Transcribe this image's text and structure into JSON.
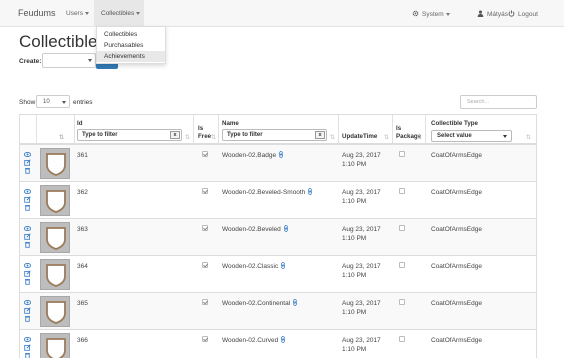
{
  "navbar": {
    "brand": "Feudums",
    "users": "Users",
    "collectibles": "Collectibles",
    "system": "System",
    "user_name": "Mátyás",
    "logout": "Logout"
  },
  "dropdown": {
    "items": [
      "Collectibles",
      "Purchasables",
      "Achievements"
    ],
    "active_index": 2
  },
  "page": {
    "title": "Collectibles",
    "create_label": "Create:"
  },
  "controls": {
    "show_label": "Show",
    "page_size": "10",
    "entries_label": "entries",
    "search_placeholder": "Search..."
  },
  "table": {
    "columns": {
      "id": "Id",
      "is_free": "Is Free",
      "name": "Name",
      "update_time": "UpdateTime",
      "is_package": "Is Package",
      "collectible_type": "Collectible Type"
    },
    "filter_placeholder": "Type to filter",
    "filter_clear": "x",
    "type_select": "Select value",
    "rows": [
      {
        "id": "361",
        "is_free": true,
        "name": "Wooden-02.Badge",
        "update_date": "Aug 23, 2017",
        "update_time": "1:10 PM",
        "is_package": false,
        "type": "CoatOfArmsEdge"
      },
      {
        "id": "362",
        "is_free": true,
        "name": "Wooden-02.Beveled-Smooth",
        "update_date": "Aug 23, 2017",
        "update_time": "1:10 PM",
        "is_package": false,
        "type": "CoatOfArmsEdge"
      },
      {
        "id": "363",
        "is_free": true,
        "name": "Wooden-02.Beveled",
        "update_date": "Aug 23, 2017",
        "update_time": "1:10 PM",
        "is_package": false,
        "type": "CoatOfArmsEdge"
      },
      {
        "id": "364",
        "is_free": true,
        "name": "Wooden-02.Classic",
        "update_date": "Aug 23, 2017",
        "update_time": "1:10 PM",
        "is_package": false,
        "type": "CoatOfArmsEdge"
      },
      {
        "id": "365",
        "is_free": true,
        "name": "Wooden-02.Continental",
        "update_date": "Aug 23, 2017",
        "update_time": "1:10 PM",
        "is_package": false,
        "type": "CoatOfArmsEdge"
      },
      {
        "id": "366",
        "is_free": true,
        "name": "Wooden-02.Curved",
        "update_date": "Aug 23, 2017",
        "update_time": "1:10 PM",
        "is_package": false,
        "type": "CoatOfArmsEdge"
      }
    ]
  },
  "colors": {
    "primary": "#337ab7",
    "link": "#3a7ec8",
    "navbar_bg": "#f7f7f7"
  }
}
